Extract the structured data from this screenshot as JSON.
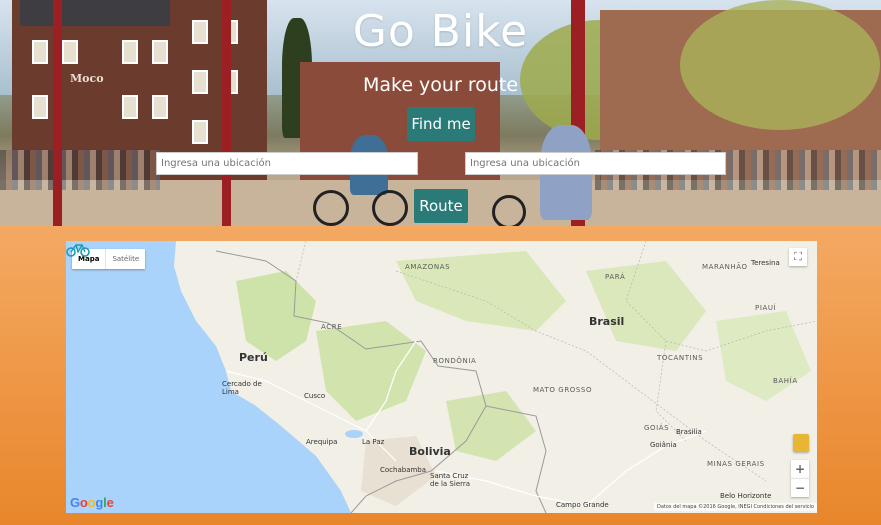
{
  "header": {
    "title": "Go Bike",
    "subtitle": "Make your route",
    "find_button": "Find me",
    "route_button": "Route",
    "origin_placeholder": "Ingresa una ubicación",
    "destination_placeholder": "Ingresa una ubicación",
    "photo_sign": "Moco"
  },
  "map": {
    "type_options": [
      "Mapa",
      "Satélite"
    ],
    "selected_type": "Mapa",
    "zoom_in": "+",
    "zoom_out": "−",
    "fullscreen_icon": "fullscreen-icon",
    "pegman_icon": "pegman-icon",
    "marker_icon": "bicycle-icon",
    "logo": "Google",
    "attribution": "Datos del mapa ©2016 Google, INEGI   Condiciones del servicio",
    "labels": {
      "amazonas": "AMAZONAS",
      "para": "PARÁ",
      "maranhao": "MARANHÃO",
      "teresina": "Teresina",
      "acre": "ACRE",
      "piaui": "PIAUÍ",
      "brasil": "Brasil",
      "peru": "Perú",
      "cercado": "Cercado de Lima",
      "rondonia": "RONDÔNIA",
      "tocantins": "TOCANTINS",
      "bahia": "BAHÍA",
      "mato_grosso": "MATO GROSSO",
      "cusco": "Cusco",
      "arequipa": "Arequipa",
      "lapaz": "La Paz",
      "bolivia": "Bolivia",
      "goias": "GOIÁS",
      "brasilia": "Brasilia",
      "goiania": "Goiânia",
      "cochabamba": "Cochabamba",
      "santacruz": "Santa Cruz de la Sierra",
      "minas": "MINAS GERAIS",
      "campo": "Campo Grande",
      "belo": "Belo Horizonte"
    }
  },
  "colors": {
    "button": "#2a7a78",
    "page_gradient_top": "#f8c28f",
    "page_gradient_bottom": "#e8862b",
    "water": "#a9d3fb",
    "land": "#f1efe6",
    "forest": "#c6e09a"
  }
}
